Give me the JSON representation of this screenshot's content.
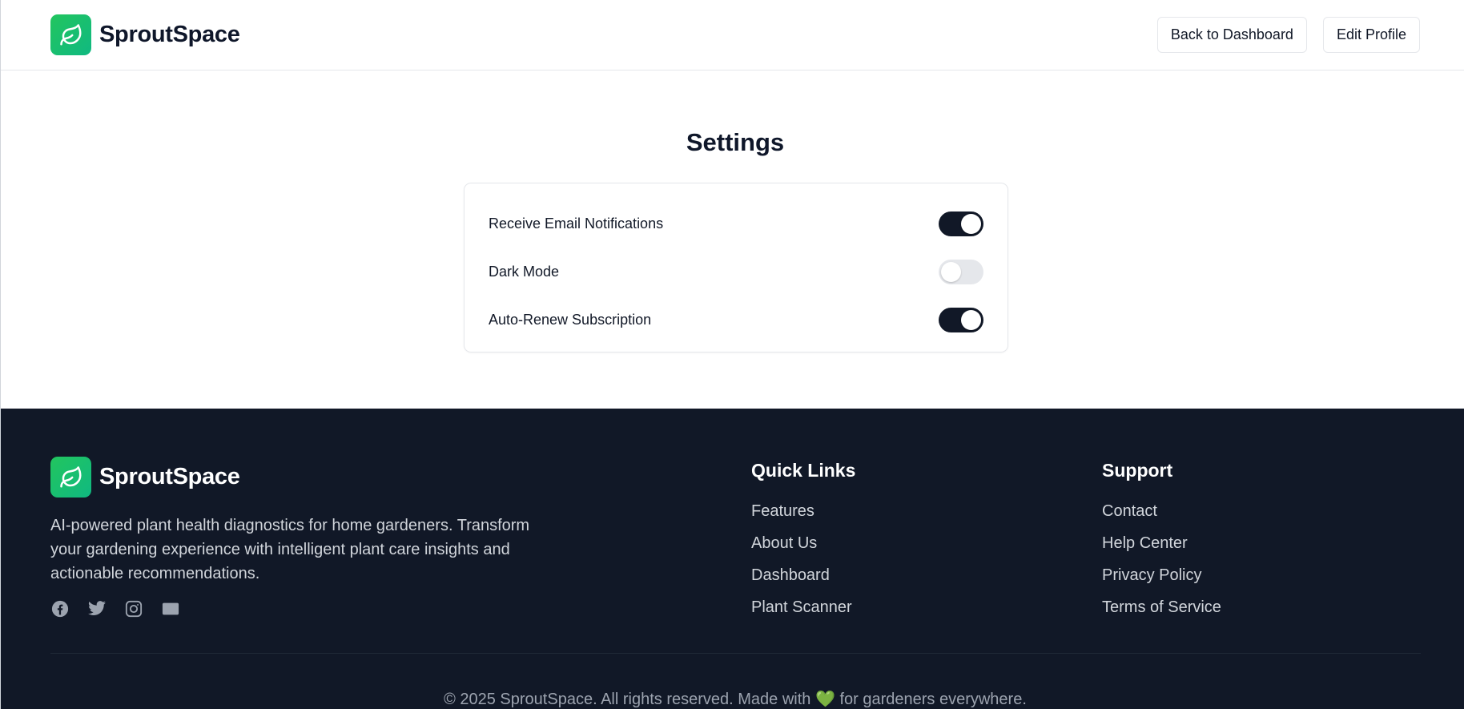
{
  "header": {
    "brand_name": "SproutSpace",
    "logo_icon": "leaf-icon",
    "back_button": "Back to Dashboard",
    "edit_button": "Edit Profile"
  },
  "settings": {
    "title": "Settings",
    "items": [
      {
        "label": "Receive Email Notifications",
        "enabled": true
      },
      {
        "label": "Dark Mode",
        "enabled": false
      },
      {
        "label": "Auto-Renew Subscription",
        "enabled": true
      }
    ]
  },
  "footer": {
    "brand_name": "SproutSpace",
    "description": "AI-powered plant health diagnostics for home gardeners. Transform your gardening experience with intelligent plant care insights and actionable recommendations.",
    "socials": [
      "facebook-icon",
      "twitter-icon",
      "instagram-icon",
      "mail-icon"
    ],
    "quick_links": {
      "title": "Quick Links",
      "links": [
        "Features",
        "About Us",
        "Dashboard",
        "Plant Scanner"
      ]
    },
    "support": {
      "title": "Support",
      "links": [
        "Contact",
        "Help Center",
        "Privacy Policy",
        "Terms of Service"
      ]
    },
    "copyright_before": "© 2025 SproutSpace. All rights reserved. Made with",
    "heart": "💚",
    "copyright_after": "for gardeners everywhere."
  },
  "colors": {
    "brand_green": "#22c55e",
    "footer_bg": "#111827",
    "toggle_on": "#111827",
    "toggle_off": "#e5e7eb"
  }
}
